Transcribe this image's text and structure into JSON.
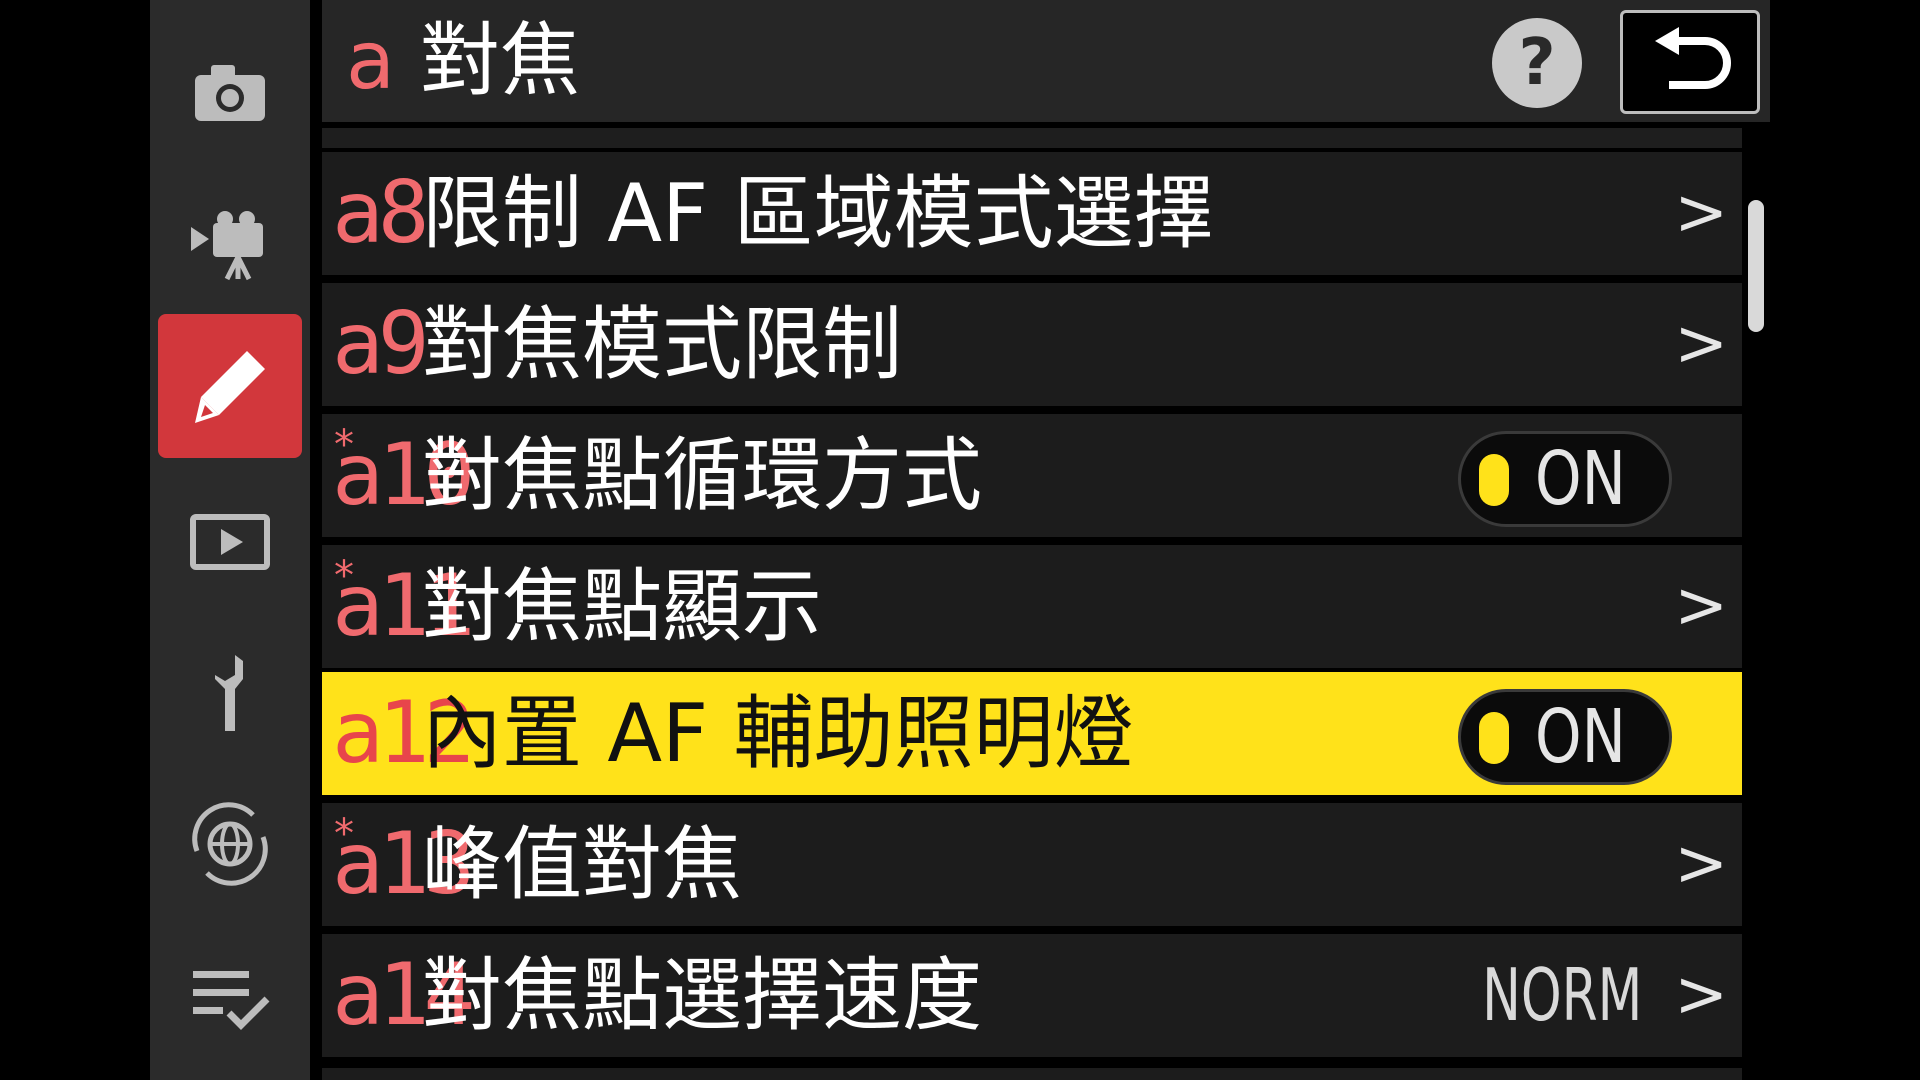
{
  "header": {
    "code": "a",
    "title": "對焦",
    "help_label": "?",
    "back_icon": "return-arrow-icon"
  },
  "sidebar": {
    "tabs": [
      {
        "name": "photo-shooting-menu",
        "icon": "camera-icon",
        "active": false
      },
      {
        "name": "movie-recording-menu",
        "icon": "movie-camera-icon",
        "active": false
      },
      {
        "name": "custom-settings-menu",
        "icon": "pencil-icon",
        "active": true
      },
      {
        "name": "playback-menu",
        "icon": "playback-icon",
        "active": false
      },
      {
        "name": "setup-menu",
        "icon": "wrench-icon",
        "active": false
      },
      {
        "name": "network-menu",
        "icon": "network-globe-icon",
        "active": false
      },
      {
        "name": "my-menu",
        "icon": "my-menu-list-icon",
        "active": false
      }
    ]
  },
  "menu": {
    "items": [
      {
        "code": "a8",
        "starred": false,
        "label": "限制 AF 區域模式選擇",
        "value": "",
        "control": "chevron"
      },
      {
        "code": "a9",
        "starred": false,
        "label": "對焦模式限制",
        "value": "",
        "control": "chevron"
      },
      {
        "code": "a10",
        "starred": true,
        "label": "對焦點循環方式",
        "value": "ON",
        "control": "toggle"
      },
      {
        "code": "a11",
        "starred": true,
        "label": "對焦點顯示",
        "value": "",
        "control": "chevron"
      },
      {
        "code": "a12",
        "starred": false,
        "label": "內置 AF 輔助照明燈",
        "value": "ON",
        "control": "toggle",
        "selected": true
      },
      {
        "code": "a13",
        "starred": true,
        "label": "峰值對焦",
        "value": "",
        "control": "chevron"
      },
      {
        "code": "a14",
        "starred": false,
        "label": "對焦點選擇速度",
        "value": "NORM",
        "control": "chevron"
      }
    ],
    "chevron_glyph": ">",
    "star_glyph": "*"
  },
  "colors": {
    "accent_red": "#f06a6e",
    "active_tab": "#d2373c",
    "highlight_yellow": "#ffe21a",
    "row_bg": "#1c1c1c"
  }
}
